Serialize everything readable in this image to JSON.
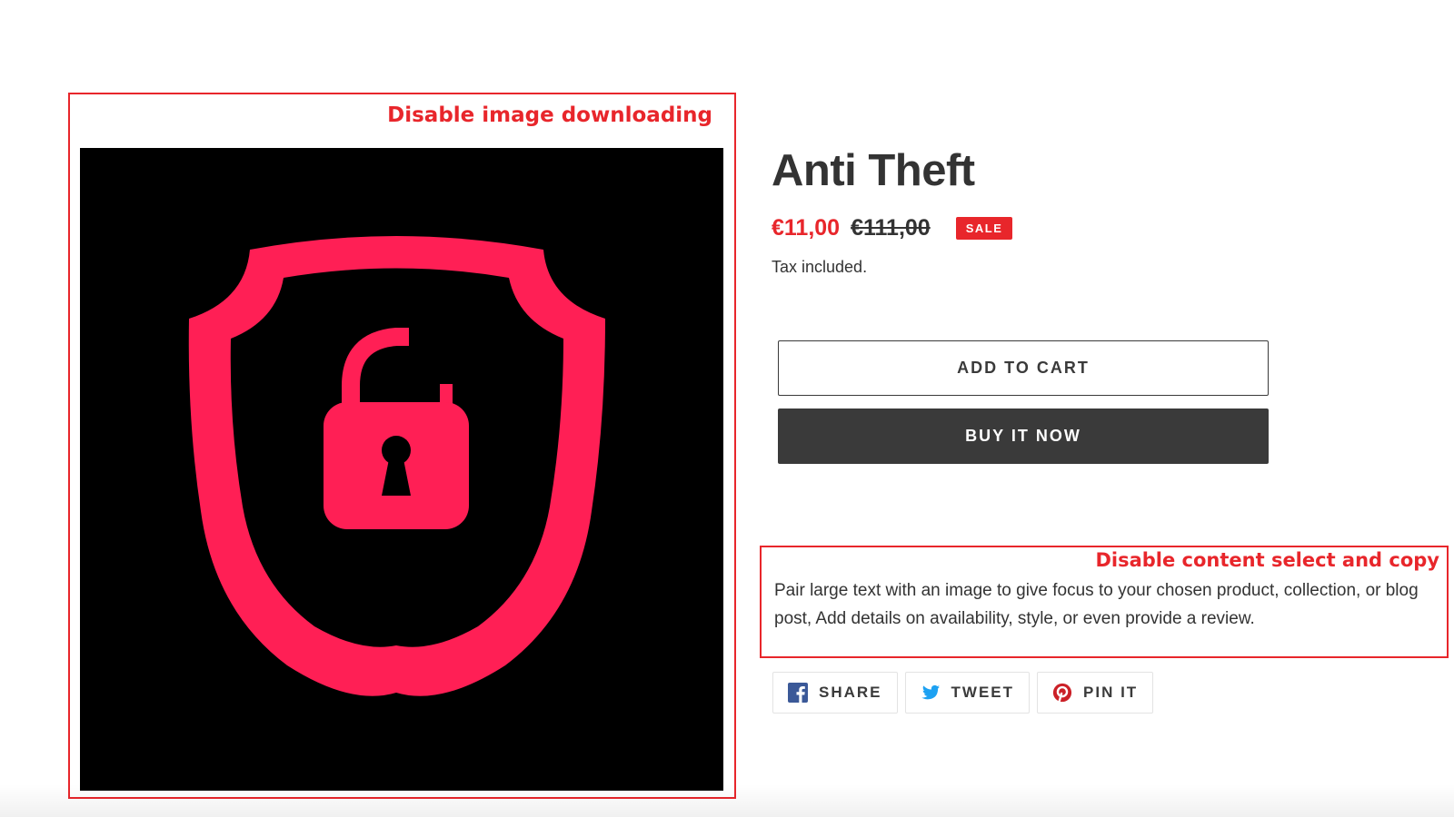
{
  "annotations": {
    "image": "Disable image downloading",
    "content": "Disable content select and copy"
  },
  "product": {
    "image_icon": "shield-unlocked-padlock-icon",
    "title": "Anti Theft",
    "sale_price": "€11,00",
    "regular_price": "€111,00",
    "sale_badge": "SALE",
    "tax_note": "Tax included.",
    "description": "Pair large text with an image to give focus to your chosen product, collection, or blog post, Add details on availability, style, or even provide a review."
  },
  "buttons": {
    "add_to_cart": "ADD TO CART",
    "buy_now": "BUY IT NOW"
  },
  "share": [
    {
      "label": "SHARE",
      "icon": "facebook-icon"
    },
    {
      "label": "TWEET",
      "icon": "twitter-icon"
    },
    {
      "label": "PIN IT",
      "icon": "pinterest-icon"
    }
  ],
  "colors": {
    "accent": "#e8262b",
    "shield": "#ff1f55",
    "image_background": "#000000",
    "primary_button": "#3a3a3a",
    "facebook": "#3b5998",
    "twitter": "#1da1f2",
    "pinterest": "#cb2027"
  }
}
